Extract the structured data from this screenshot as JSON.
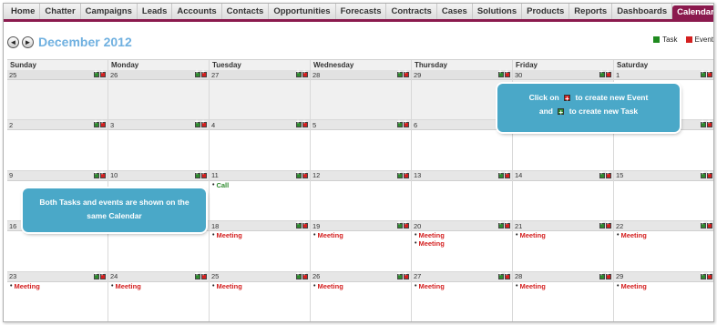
{
  "tabs": [
    {
      "label": "Home",
      "active": false
    },
    {
      "label": "Chatter",
      "active": false
    },
    {
      "label": "Campaigns",
      "active": false
    },
    {
      "label": "Leads",
      "active": false
    },
    {
      "label": "Accounts",
      "active": false
    },
    {
      "label": "Contacts",
      "active": false
    },
    {
      "label": "Opportunities",
      "active": false
    },
    {
      "label": "Forecasts",
      "active": false
    },
    {
      "label": "Contracts",
      "active": false
    },
    {
      "label": "Cases",
      "active": false
    },
    {
      "label": "Solutions",
      "active": false
    },
    {
      "label": "Products",
      "active": false
    },
    {
      "label": "Reports",
      "active": false
    },
    {
      "label": "Dashboards",
      "active": false
    },
    {
      "label": "Calendar",
      "active": true
    }
  ],
  "tab_extra": {
    "plus": "+",
    "caret": "▼"
  },
  "header": {
    "month_title": "December 2012",
    "prev_icon": "◄",
    "next_icon": "►"
  },
  "legend": [
    {
      "label": "Task",
      "color": "#1f8a1f"
    },
    {
      "label": "Event",
      "color": "#d42020"
    }
  ],
  "weekdays": [
    "Sunday",
    "Monday",
    "Tuesday",
    "Wednesday",
    "Thursday",
    "Friday",
    "Saturday"
  ],
  "weeks": [
    [
      {
        "day": "25",
        "prev": true,
        "entries": []
      },
      {
        "day": "26",
        "prev": true,
        "entries": []
      },
      {
        "day": "27",
        "prev": true,
        "entries": []
      },
      {
        "day": "28",
        "prev": true,
        "entries": []
      },
      {
        "day": "29",
        "prev": true,
        "entries": []
      },
      {
        "day": "30",
        "prev": true,
        "entries": []
      },
      {
        "day": "1",
        "prev": false,
        "entries": []
      }
    ],
    [
      {
        "day": "2",
        "prev": false,
        "entries": []
      },
      {
        "day": "3",
        "prev": false,
        "entries": []
      },
      {
        "day": "4",
        "prev": false,
        "entries": []
      },
      {
        "day": "5",
        "prev": false,
        "entries": []
      },
      {
        "day": "6",
        "prev": false,
        "entries": []
      },
      {
        "day": "7",
        "prev": false,
        "entries": []
      },
      {
        "day": "8",
        "prev": false,
        "entries": []
      }
    ],
    [
      {
        "day": "9",
        "prev": false,
        "entries": []
      },
      {
        "day": "10",
        "prev": false,
        "entries": []
      },
      {
        "day": "11",
        "prev": false,
        "entries": [
          {
            "label": "Call",
            "kind": "call"
          }
        ]
      },
      {
        "day": "12",
        "prev": false,
        "entries": []
      },
      {
        "day": "13",
        "prev": false,
        "entries": []
      },
      {
        "day": "14",
        "prev": false,
        "entries": []
      },
      {
        "day": "15",
        "prev": false,
        "entries": []
      }
    ],
    [
      {
        "day": "16",
        "prev": false,
        "entries": []
      },
      {
        "day": "17",
        "prev": false,
        "entries": []
      },
      {
        "day": "18",
        "prev": false,
        "entries": [
          {
            "label": "Meeting",
            "kind": "meeting"
          }
        ]
      },
      {
        "day": "19",
        "prev": false,
        "entries": [
          {
            "label": "Meeting",
            "kind": "meeting"
          }
        ]
      },
      {
        "day": "20",
        "prev": false,
        "entries": [
          {
            "label": "Meeting",
            "kind": "meeting"
          },
          {
            "label": "Meeting",
            "kind": "meeting"
          }
        ]
      },
      {
        "day": "21",
        "prev": false,
        "entries": [
          {
            "label": "Meeting",
            "kind": "meeting"
          }
        ]
      },
      {
        "day": "22",
        "prev": false,
        "entries": [
          {
            "label": "Meeting",
            "kind": "meeting"
          }
        ]
      }
    ],
    [
      {
        "day": "23",
        "prev": false,
        "entries": [
          {
            "label": "Meeting",
            "kind": "meeting"
          }
        ]
      },
      {
        "day": "24",
        "prev": false,
        "entries": [
          {
            "label": "Meeting",
            "kind": "meeting"
          }
        ]
      },
      {
        "day": "25",
        "prev": false,
        "entries": [
          {
            "label": "Meeting",
            "kind": "meeting"
          }
        ]
      },
      {
        "day": "26",
        "prev": false,
        "entries": [
          {
            "label": "Meeting",
            "kind": "meeting"
          }
        ]
      },
      {
        "day": "27",
        "prev": false,
        "entries": [
          {
            "label": "Meeting",
            "kind": "meeting"
          }
        ]
      },
      {
        "day": "28",
        "prev": false,
        "entries": [
          {
            "label": "Meeting",
            "kind": "meeting"
          }
        ]
      },
      {
        "day": "29",
        "prev": false,
        "entries": [
          {
            "label": "Meeting",
            "kind": "meeting"
          }
        ]
      }
    ]
  ],
  "callouts": {
    "new_item": {
      "line1_prefix": "Click on",
      "line1_suffix": "to create new Event",
      "line2_prefix": "and",
      "line2_suffix": "to create new Task"
    },
    "shared": {
      "text": "Both Tasks and events are shown on the same Calendar"
    }
  }
}
